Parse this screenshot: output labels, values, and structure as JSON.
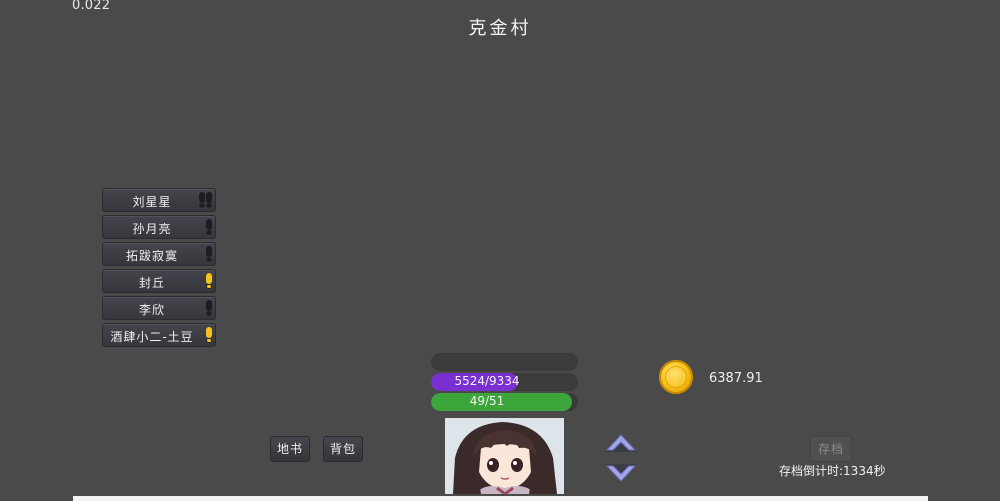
{
  "version": "0.022",
  "location_title": "克金村",
  "npcs": [
    {
      "name": "刘星星",
      "marks": [
        "gray",
        "gray"
      ]
    },
    {
      "name": "孙月亮",
      "marks": [
        "gray"
      ]
    },
    {
      "name": "拓跋寂寞",
      "marks": [
        "gray"
      ]
    },
    {
      "name": "封丘",
      "marks": [
        "gold"
      ]
    },
    {
      "name": "李欣",
      "marks": [
        "gray"
      ]
    },
    {
      "name": "酒肆小二-土豆",
      "marks": [
        "gold"
      ]
    }
  ],
  "stats": {
    "top_bar": {
      "fill_fraction": 0,
      "color": "#3b3b3b",
      "text": ""
    },
    "hp": {
      "text": "5524/9334",
      "current": 5524,
      "max": 9334,
      "color": "#7a2fd1"
    },
    "mp": {
      "text": "49/51",
      "current": 49,
      "max": 51,
      "color": "#3ca53c"
    }
  },
  "gold": {
    "amount": "6387.91",
    "icon": "gold-coin-icon"
  },
  "buttons": {
    "map_book": "地书",
    "backpack": "背包",
    "save": "存档",
    "up_icon": "chevron-up-icon",
    "down_icon": "chevron-down-icon"
  },
  "save_countdown": "存档倒计时:1334秒",
  "colors": {
    "background": "#4a4a4a",
    "gold_mark": "#f4c21a",
    "arrow": "#9b9ee0"
  }
}
